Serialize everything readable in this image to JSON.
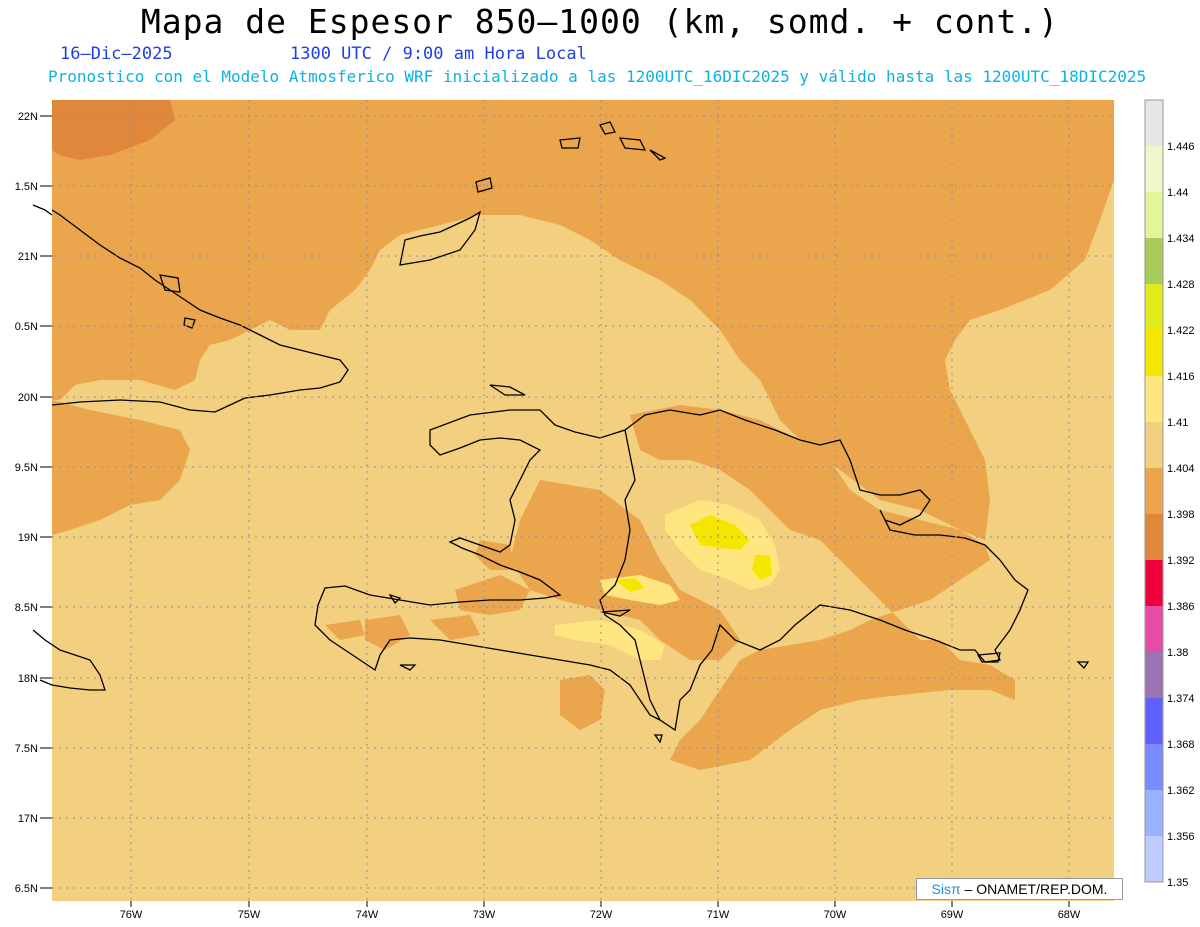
{
  "header": {
    "title": "Mapa de Espesor 850–1000 (km, somd. + cont.)",
    "date": "16–Dic–2025",
    "time": "1300 UTC / 9:00 am Hora Local",
    "forecast_note": "Pronostico con el Modelo Atmosferico WRF inicializado a las 1200UTC_16DIC2025 y válido hasta las  1200UTC_18DIC2025"
  },
  "axes": {
    "lat_labels": [
      "22N",
      "1.5N",
      "21N",
      "0.5N",
      "20N",
      "9.5N",
      "19N",
      "8.5N",
      "18N",
      "7.5N",
      "17N",
      "6.5N"
    ],
    "lon_labels": [
      "76W",
      "75W",
      "74W",
      "73W",
      "72W",
      "71W",
      "70W",
      "69W",
      "68W"
    ]
  },
  "colorbar": {
    "labels": [
      "1.446",
      "1.44",
      "1.434",
      "1.428",
      "1.422",
      "1.416",
      "1.41",
      "1.404",
      "1.398",
      "1.392",
      "1.386",
      "1.38",
      "1.374",
      "1.368",
      "1.362",
      "1.356",
      "1.35"
    ],
    "colors": [
      "#e6e6e6",
      "#f0f5cc",
      "#e2f59a",
      "#a8cc5c",
      "#e0eb1a",
      "#f5e600",
      "#ffe680",
      "#f2d080",
      "#eba54d",
      "#e0873c",
      "#f0003c",
      "#e64ca5",
      "#9a73b3",
      "#6060ff",
      "#7a8cff",
      "#99b3ff",
      "#c0ccff"
    ]
  },
  "map": {
    "background_color": "#f2d080",
    "warm_color": "#eba54d",
    "hot_color": "#e0873c",
    "yellow_color": "#ffe680",
    "peak_color": "#f5e600"
  },
  "credit": {
    "brand": "Sisπ",
    "text": " – ONAMET/REP.DOM."
  }
}
